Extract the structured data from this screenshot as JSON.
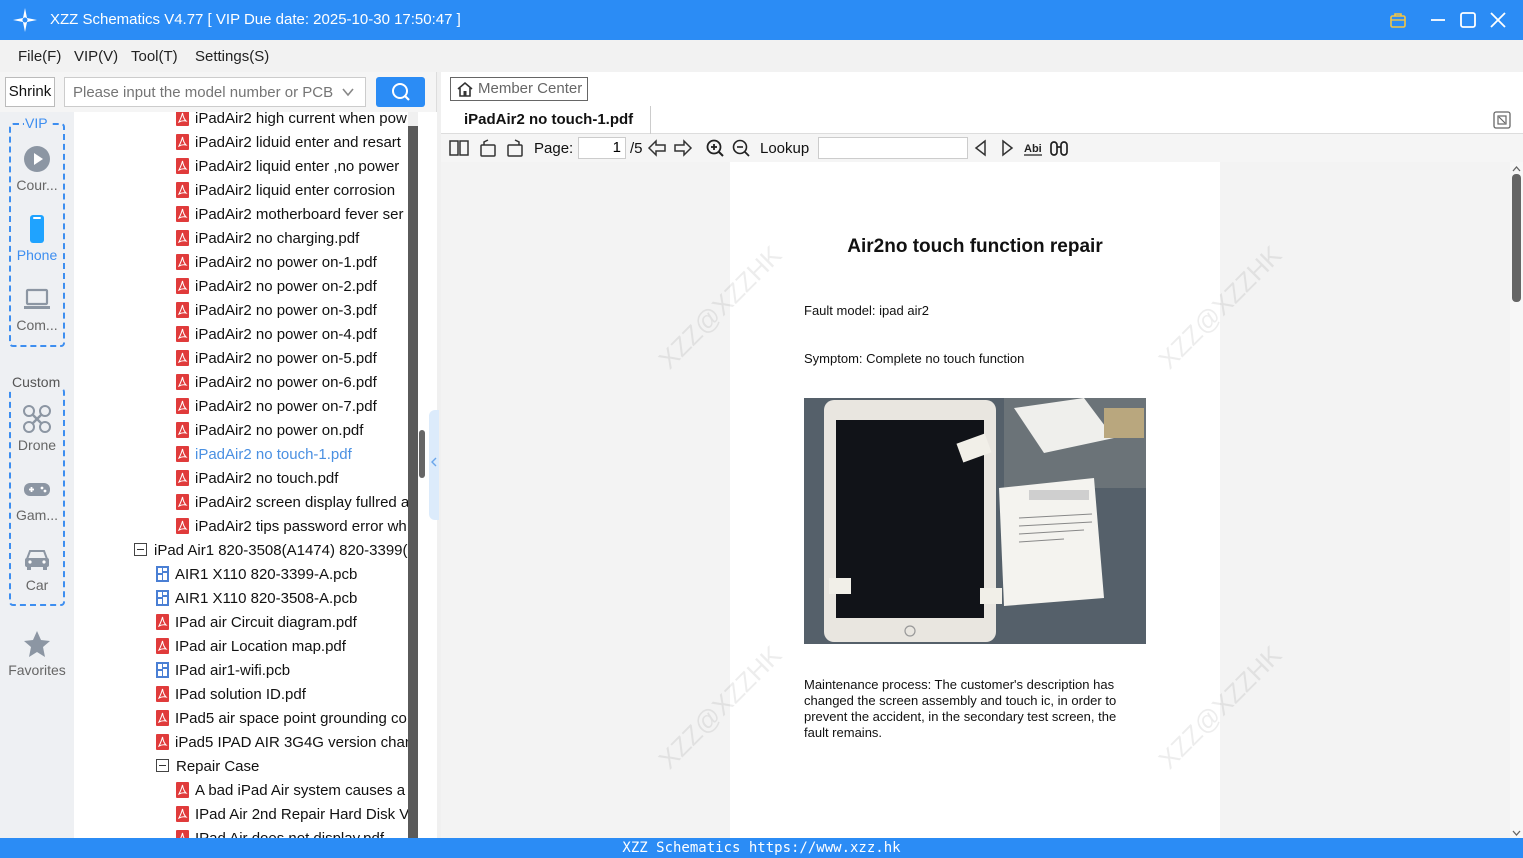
{
  "window": {
    "title": "XZZ Schematics V4.77 [ VIP Due date: 2025-10-30 17:50:47 ]"
  },
  "menu": [
    "File(F)",
    "VIP(V)",
    "Tool(T)",
    "Settings(S)"
  ],
  "search": {
    "shrink_label": "Shrink",
    "placeholder": "Please input the model number or PCB"
  },
  "sidebar": {
    "vip_label": "VIP",
    "custom_label": "Custom",
    "items": [
      {
        "label": "Cour...",
        "icon": "play-icon"
      },
      {
        "label": "Phone",
        "icon": "phone-icon"
      },
      {
        "label": "Com...",
        "icon": "laptop-icon"
      },
      {
        "label": "Drone",
        "icon": "drone-icon"
      },
      {
        "label": "Gam...",
        "icon": "gamepad-icon"
      },
      {
        "label": "Car",
        "icon": "car-icon"
      },
      {
        "label": "Favorites",
        "icon": "star-icon"
      }
    ]
  },
  "tree": {
    "rows": [
      {
        "label": "iPadAir2 high current when pow",
        "type": "pdf",
        "level": 2
      },
      {
        "label": "iPadAir2 liduid enter and resart",
        "type": "pdf",
        "level": 2
      },
      {
        "label": "iPadAir2 liquid enter ,no power",
        "type": "pdf",
        "level": 2
      },
      {
        "label": "iPadAir2 liquid enter corrosion",
        "type": "pdf",
        "level": 2
      },
      {
        "label": "iPadAir2 motherboard fever ser",
        "type": "pdf",
        "level": 2
      },
      {
        "label": "iPadAir2 no charging.pdf",
        "type": "pdf",
        "level": 2
      },
      {
        "label": "iPadAir2 no power on-1.pdf",
        "type": "pdf",
        "level": 2
      },
      {
        "label": "iPadAir2 no power on-2.pdf",
        "type": "pdf",
        "level": 2
      },
      {
        "label": "iPadAir2 no power on-3.pdf",
        "type": "pdf",
        "level": 2
      },
      {
        "label": "iPadAir2 no power on-4.pdf",
        "type": "pdf",
        "level": 2
      },
      {
        "label": "iPadAir2 no power on-5.pdf",
        "type": "pdf",
        "level": 2
      },
      {
        "label": "iPadAir2 no power on-6.pdf",
        "type": "pdf",
        "level": 2
      },
      {
        "label": "iPadAir2 no power on-7.pdf",
        "type": "pdf",
        "level": 2
      },
      {
        "label": "iPadAir2 no power on.pdf",
        "type": "pdf",
        "level": 2
      },
      {
        "label": "iPadAir2 no touch-1.pdf",
        "type": "pdf",
        "level": 2,
        "selected": true
      },
      {
        "label": "iPadAir2 no touch.pdf",
        "type": "pdf",
        "level": 2
      },
      {
        "label": "iPadAir2 screen display fullred a",
        "type": "pdf",
        "level": 2
      },
      {
        "label": "iPadAir2 tips password error wh",
        "type": "pdf",
        "level": 2
      },
      {
        "label": "iPad Air1 820-3508(A1474) 820-3399(",
        "type": "folder",
        "level": 0
      },
      {
        "label": "AIR1 X110 820-3399-A.pcb",
        "type": "pcb",
        "level": 1
      },
      {
        "label": "AIR1 X110 820-3508-A.pcb",
        "type": "pcb",
        "level": 1
      },
      {
        "label": "IPad air Circuit diagram.pdf",
        "type": "pdf",
        "level": 1
      },
      {
        "label": "IPad air Location map.pdf",
        "type": "pdf",
        "level": 1
      },
      {
        "label": "IPad air1-wifi.pcb",
        "type": "pcb",
        "level": 1
      },
      {
        "label": "IPad solution ID.pdf",
        "type": "pdf",
        "level": 1
      },
      {
        "label": "IPad5 air space point grounding co",
        "type": "pdf",
        "level": 1
      },
      {
        "label": "iPad5 IPAD AIR 3G4G version chan",
        "type": "pdf",
        "level": 1
      },
      {
        "label": "Repair Case",
        "type": "folder",
        "level": 1
      },
      {
        "label": "A bad iPad Air system causes a",
        "type": "pdf",
        "level": 2
      },
      {
        "label": "IPad Air 2nd Repair Hard Disk V",
        "type": "pdf",
        "level": 2
      },
      {
        "label": "IPad Air does not display.pdf",
        "type": "pdf",
        "level": 2
      }
    ]
  },
  "viewer": {
    "member_center": "Member Center",
    "tab_title": "iPadAir2 no touch-1.pdf",
    "page_label": "Page:",
    "page_current": "1",
    "page_total": "/5",
    "lookup_label": "Lookup"
  },
  "document": {
    "title": "Air2no touch function repair",
    "fault_model": "Fault model: ipad air2",
    "symptom": "Symptom: Complete no touch function",
    "process": "Maintenance process: The customer's description has changed the screen assembly and touch ic, in order to prevent the accident, in the secondary test screen, the fault remains.",
    "watermark": "XZZ@XZZHK"
  },
  "status": {
    "text": "XZZ Schematics https://www.xzz.hk"
  },
  "colors": {
    "accent": "#2b8cf5",
    "pdf_icon": "#e03b3b",
    "pcb_icon": "#4a7fd4",
    "selected_text": "#4a90e2"
  }
}
